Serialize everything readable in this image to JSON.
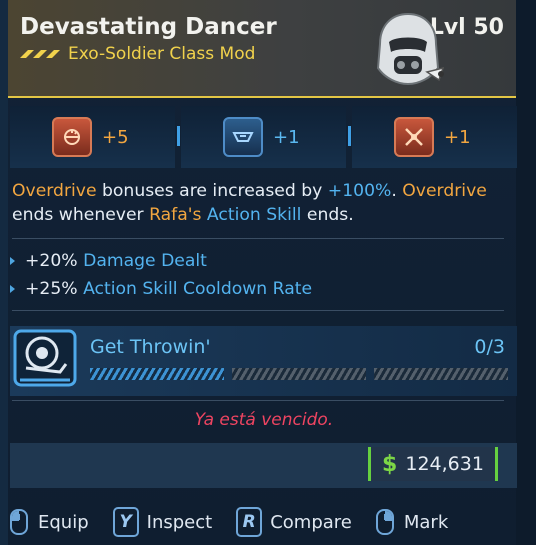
{
  "item": {
    "name": "Devastating Dancer",
    "type": "Exo-Soldier Class Mod",
    "level": "Lvl 50",
    "rarity_color": "#f1d24c"
  },
  "skills": [
    {
      "icon": "explosive-skill-icon",
      "value": "+5",
      "color": "#f2a640"
    },
    {
      "icon": "tech-skill-icon",
      "value": "+1",
      "color": "#5ab8f0"
    },
    {
      "icon": "crossed-blades-skill-icon",
      "value": "+1",
      "color": "#f2a640"
    }
  ],
  "description": {
    "p1": "Overdrive",
    "p2": " bonuses are increased by ",
    "p3": "+100%",
    "p4": ". ",
    "p5": "Overdrive",
    "p6": "ends whenever ",
    "p7": "Rafa's",
    "p8": " ",
    "p9": "Action Skill",
    "p10": " ends."
  },
  "stats": [
    {
      "amount": "+20%",
      "label": "Damage Dealt"
    },
    {
      "amount": "+25%",
      "label": "Action Skill Cooldown Rate"
    }
  ],
  "challenge": {
    "title": "Get Throwin'",
    "progress_text": "0/3",
    "progress_value": 0,
    "progress_max": 3
  },
  "error_message": "Ya está vencido.",
  "price": {
    "symbol": "$",
    "amount": "124,631"
  },
  "actions": [
    {
      "key": "mouse-left-icon",
      "label": "Equip"
    },
    {
      "key": "Y",
      "label": "Inspect"
    },
    {
      "key": "R",
      "label": "Compare"
    },
    {
      "key": "mouse-right-icon",
      "label": "Mark"
    }
  ]
}
